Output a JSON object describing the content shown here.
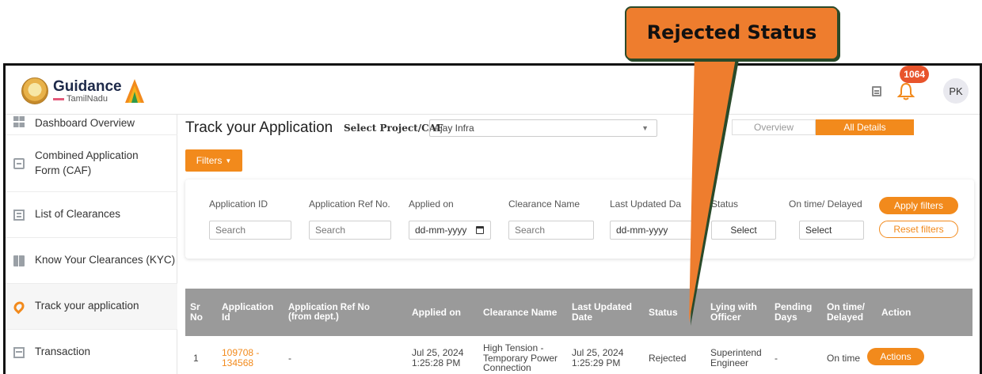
{
  "callout": {
    "text": "Rejected Status"
  },
  "header": {
    "logo_main": "Guidance",
    "logo_sub": "TamilNadu",
    "notification_count": "1064",
    "avatar_initials": "PK"
  },
  "sidebar": {
    "items": [
      {
        "label": "Dashboard Overview",
        "icon": "grid-icon"
      },
      {
        "label": "Combined Application Form (CAF)",
        "icon": "document-icon"
      },
      {
        "label": "List of Clearances",
        "icon": "list-icon"
      },
      {
        "label": "Know Your Clearances (KYC)",
        "icon": "book-icon"
      },
      {
        "label": "Track your application",
        "icon": "location-pin-icon"
      },
      {
        "label": "Transaction",
        "icon": "card-icon"
      }
    ]
  },
  "main": {
    "title": "Track your Application",
    "project_label": "Select Project/CAF",
    "project_value": "Ajay Infra",
    "tabs": {
      "overview": "Overview",
      "all_details": "All Details"
    },
    "filters_label": "Filters",
    "filters": {
      "labels": [
        "Application ID",
        "Application Ref No.",
        "Applied on",
        "Clearance Name",
        "Last Updated Da",
        "Status",
        "On time/ Delayed"
      ],
      "inputs": [
        "Search",
        "Search",
        "dd-mm-yyyy",
        "Search",
        "dd-mm-yyyy",
        "Select",
        "Select"
      ],
      "apply": "Apply filters",
      "reset": "Reset filters"
    },
    "table": {
      "headers": [
        "Sr No",
        "Application Id",
        "Application Ref No (from dept.)",
        "Applied on",
        "Clearance Name",
        "Last Updated Date",
        "Status",
        "Lying with Officer",
        "Pending Days",
        "On time/ Delayed",
        "Action"
      ],
      "rows": [
        {
          "sr": "1",
          "app_id": "109708 - 134568",
          "ref_no": "-",
          "applied_on": "Jul 25, 2024 1:25:28 PM",
          "clearance": "High Tension - Temporary Power Connection",
          "last_updated": "Jul 25, 2024 1:25:29 PM",
          "status": "Rejected",
          "officer": "Superintend Engineer",
          "pending": "-",
          "ontime": "On time",
          "action": "Actions"
        }
      ]
    }
  },
  "colors": {
    "accent": "#f28a1c",
    "table_header": "#9a9a9a",
    "callout": "#ee7d2e"
  }
}
